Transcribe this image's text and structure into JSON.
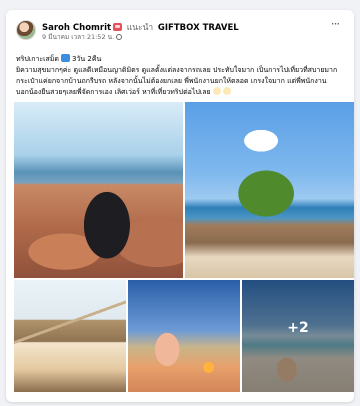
{
  "post": {
    "author": "Saroh Chomrit",
    "tag_word": "แนะนำ",
    "page_name": "GIFTBOX TRAVEL",
    "timestamp": "9 มีนาคม เวลา 21:52 น.",
    "more_symbol": "···",
    "caption": {
      "line1_a": "ทริปเกาะเสม็ด",
      "line1_b": "3วัน 2คืน",
      "line2": "ยิความสุขมากๆค่ะ ดูแลดีเหมือนญาติมิตร ดูแลตั้งแต่ลงจากรถเลย ประทับใจมาก เป็นการไปเที่ยวที่สบายมาก",
      "line3": "กระเป๋าแค่ยกจากบ้านถกรีบรถ หลังจากนั้นไม่ต้องยกเลย พี่พนักงานยกให้ตลอด เกรงใจมาก แต่พี่พนักงาน",
      "line4": "บอกน้องยืนสวยๆเลยพี่จัดการเอง เลิศเว่อร์ หาที่เที่ยวทริปต่อไปเลย"
    },
    "photos": [
      {
        "label": "woman-sitting-on-rocks-by-sea"
      },
      {
        "label": "tree-on-beach"
      },
      {
        "label": "beach-cafe-bungalow"
      },
      {
        "label": "woman-at-sunset-beach-dinner"
      },
      {
        "label": "woman-on-beach"
      }
    ],
    "more_photos": "+2"
  },
  "colors": {
    "background": "#f0f2f5",
    "card": "#ffffff",
    "text": "#050505",
    "secondary_text": "#65676b"
  },
  "icons": [
    "badge-icon",
    "globe-icon",
    "more-options-icon",
    "train-icon",
    "smile-emoji-icon"
  ]
}
